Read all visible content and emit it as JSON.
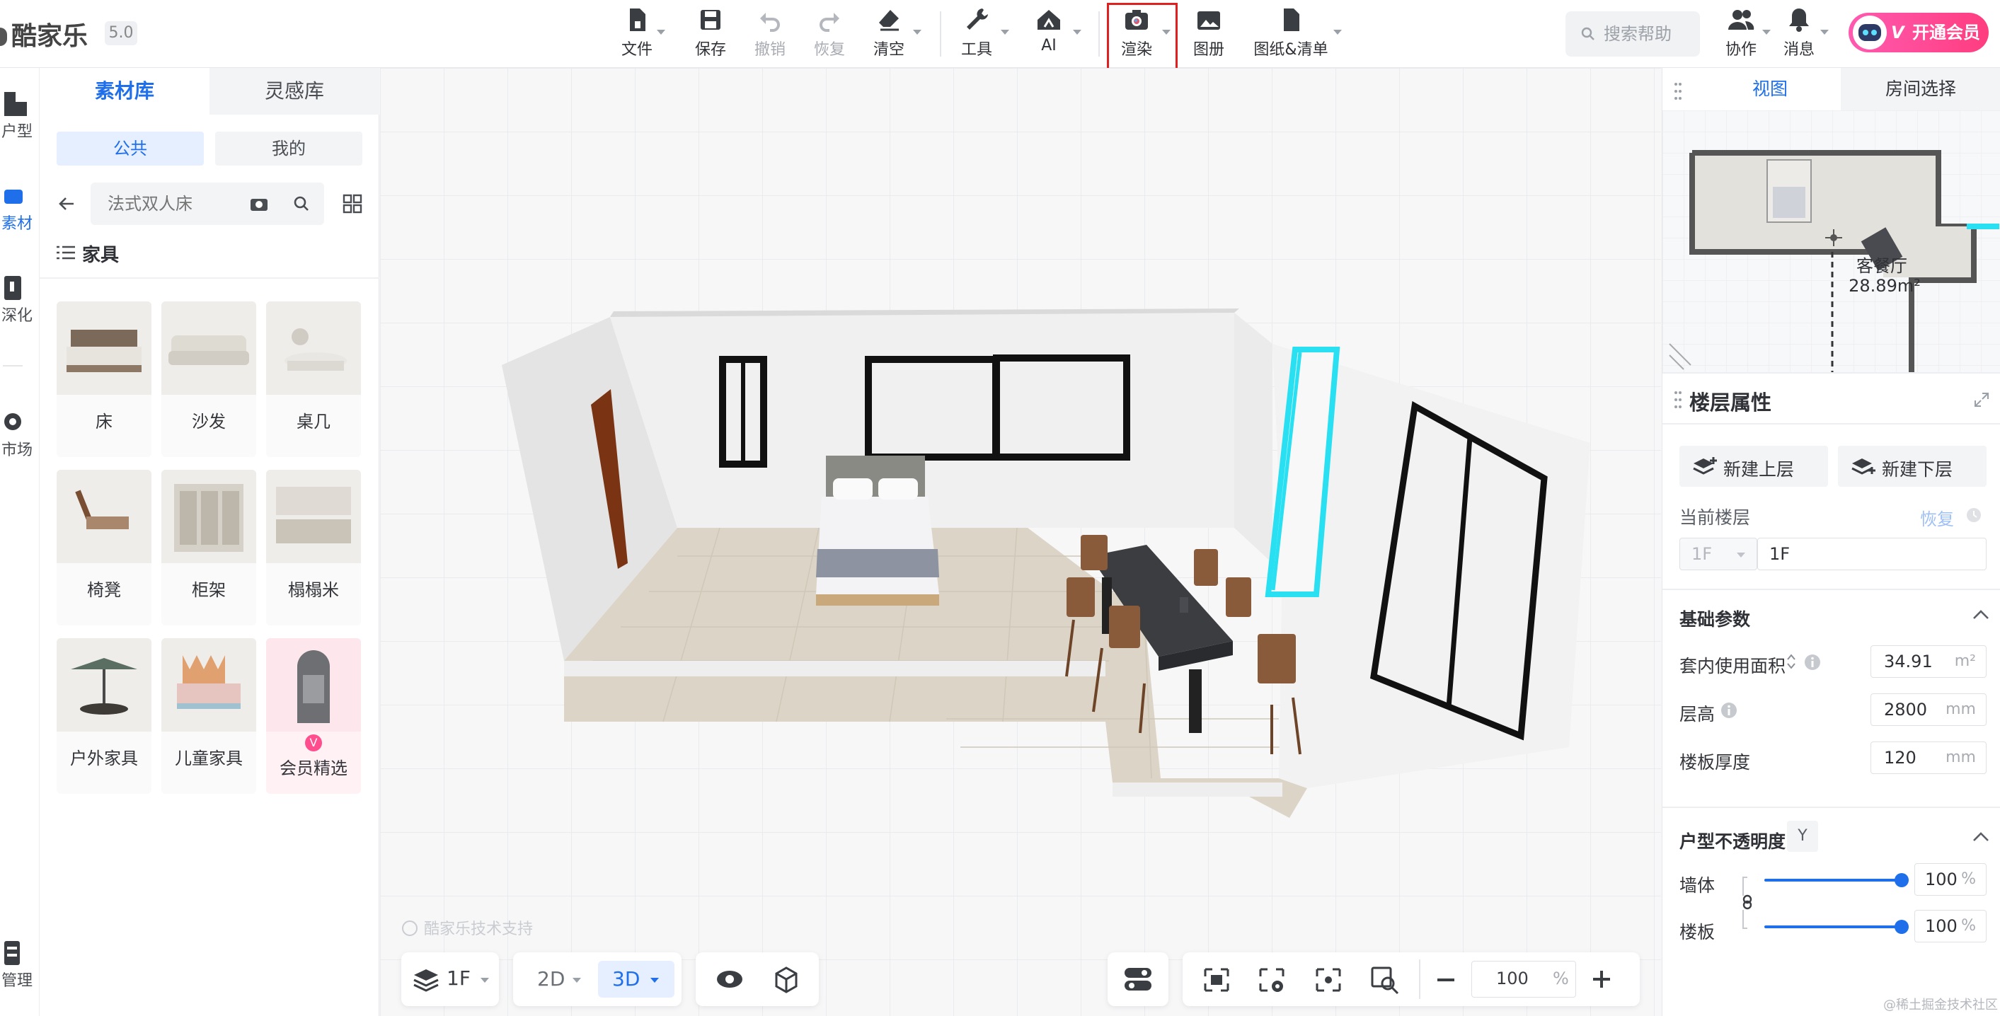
{
  "app": {
    "logo": "酷家乐",
    "version": "5.0"
  },
  "toolbar": {
    "file": "文件",
    "save": "保存",
    "undo": "撤销",
    "redo": "恢复",
    "clear": "清空",
    "tools": "工具",
    "ai": "AI",
    "render": "渲染",
    "album": "图册",
    "drawings": "图纸&清单"
  },
  "topright": {
    "search_help": "搜索帮助",
    "collab": "协作",
    "messages": "消息",
    "vip": "开通会员"
  },
  "rail": {
    "floorplan": "户型",
    "material": "素材",
    "deepen": "深化",
    "market": "市场",
    "manage": "管理"
  },
  "material_panel": {
    "tabs": [
      "素材库",
      "灵感库"
    ],
    "scope": [
      "公共",
      "我的"
    ],
    "search_placeholder": "法式双人床",
    "category": "家具",
    "items": [
      "床",
      "沙发",
      "桌几",
      "椅凳",
      "柜架",
      "榻榻米",
      "户外家具",
      "儿童家具",
      "会员精选"
    ]
  },
  "viewport": {
    "watermark": "酷家乐技术支持",
    "room_label": "客餐厅",
    "room_area": "28.89m²"
  },
  "bottom_bar": {
    "floor": "1F",
    "mode_2d": "2D",
    "mode_3d": "3D",
    "zoom": "100",
    "zoom_unit": "%"
  },
  "right_panel": {
    "tabs": [
      "视图",
      "房间选择"
    ],
    "floor_props_title": "楼层属性",
    "new_upper": "新建上层",
    "new_lower": "新建下层",
    "current_floor_label": "当前楼层",
    "restore": "恢复",
    "floor_select": "1F",
    "floor_name": "1F",
    "basic_params": "基础参数",
    "area_label": "套内使用面积",
    "area_value": "34.91",
    "area_unit": "m²",
    "height_label": "层高",
    "height_value": "2800",
    "height_unit": "mm",
    "slab_label": "楼板厚度",
    "slab_value": "120",
    "slab_unit": "mm",
    "opacity_title": "户型不透明度",
    "opacity_shortcut": "Y",
    "wall_label": "墙体",
    "wall_value": "100",
    "slab_op_label": "楼板",
    "slab_op_value": "100",
    "percent": "%"
  },
  "footer_watermark": "@稀土掘金技术社区",
  "colors": {
    "accent": "#1f6feb",
    "highlight": "#29e0f2",
    "render_box": "#e02020",
    "vip": "#ff4d8d"
  }
}
